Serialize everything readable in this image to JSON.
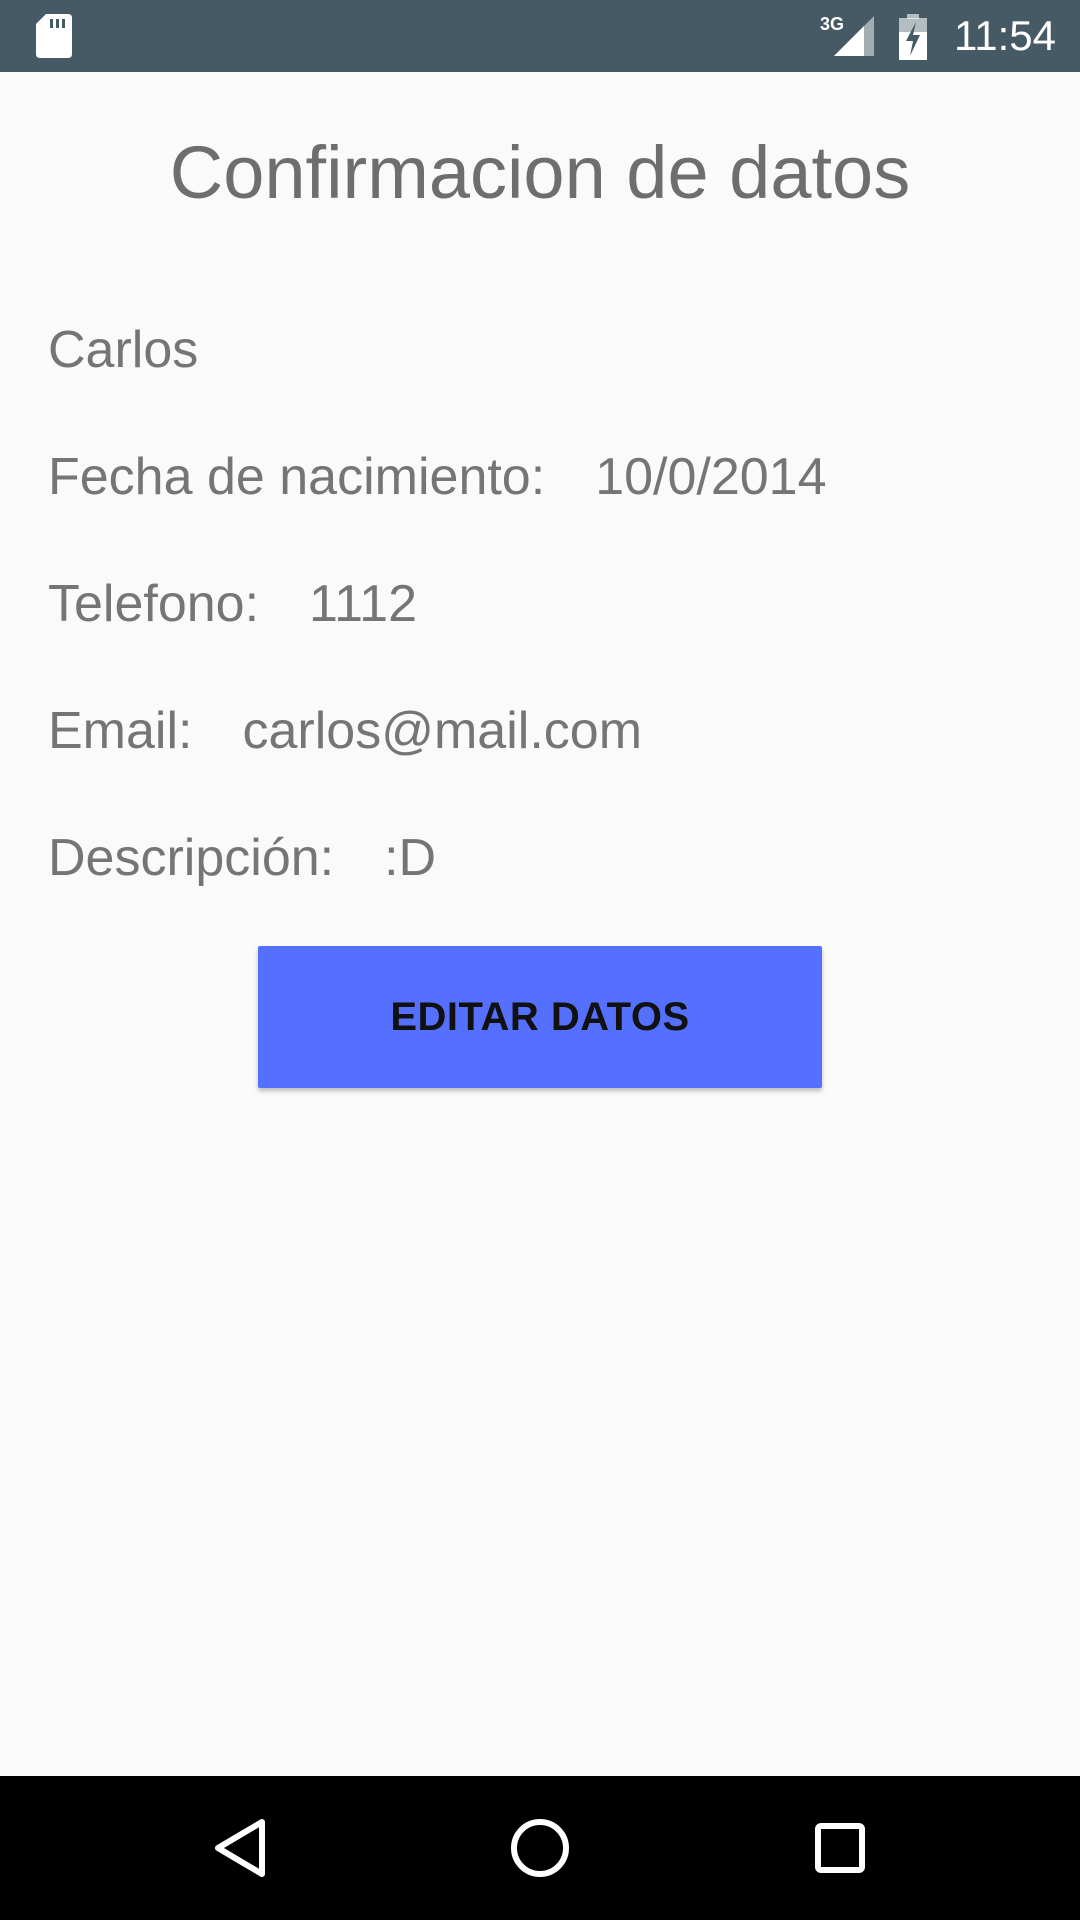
{
  "status_bar": {
    "time": "11:54",
    "network_label": "3G",
    "icons": [
      "sd-card-icon",
      "cellular-signal-icon",
      "battery-charging-icon"
    ]
  },
  "page": {
    "title": "Confirmacion de datos",
    "name": "Carlos",
    "fields": {
      "birth_label": "Fecha de nacimiento:",
      "birth_value": "10/0/2014",
      "phone_label": "Telefono:",
      "phone_value": "1112",
      "email_label": "Email:",
      "email_value": "carlos@mail.com",
      "desc_label": "Descripción:",
      "desc_value": ":D"
    },
    "edit_button_label": "EDITAR DATOS"
  },
  "nav_bar": {
    "icons": [
      "back-icon",
      "home-icon",
      "recents-icon"
    ]
  },
  "colors": {
    "status_bar": "#455a64",
    "background": "#fafafa",
    "text": "#757575",
    "button": "#5570ff",
    "nav_bar": "#000000"
  }
}
